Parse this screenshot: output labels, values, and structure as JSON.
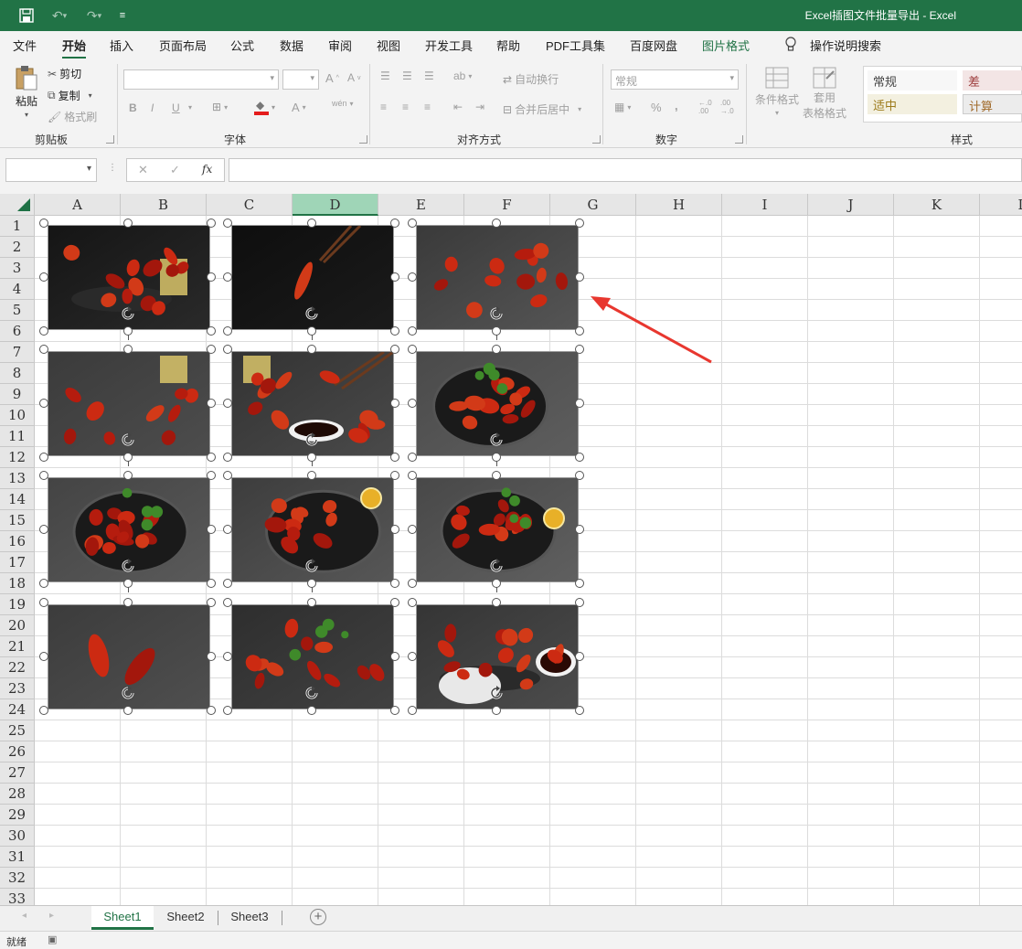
{
  "title": "Excel插图文件批量导出  -  Excel",
  "menu_tabs": [
    "文件",
    "开始",
    "插入",
    "页面布局",
    "公式",
    "数据",
    "审阅",
    "视图",
    "开发工具",
    "帮助",
    "PDF工具集",
    "百度网盘",
    "图片格式"
  ],
  "active_tab": "开始",
  "tell_me": "操作说明搜索",
  "clipboard": {
    "paste": "粘贴",
    "cut": "剪切",
    "copy": "复制",
    "format_painter": "格式刷",
    "label": "剪贴板"
  },
  "font": {
    "label": "字体",
    "bold": "B",
    "italic": "I",
    "underline": "U",
    "font_color": "A",
    "phonetic": "wén"
  },
  "alignment": {
    "label": "对齐方式",
    "wrap": "自动换行",
    "merge": "合并后居中"
  },
  "number": {
    "label": "数字",
    "format": "常规",
    "percent": "%",
    "comma": ","
  },
  "styles": {
    "label": "样式",
    "conditional": "条件格式",
    "table_line1": "套用",
    "table_line2": "表格格式",
    "cells": [
      "常规",
      "差",
      "适中",
      "计算"
    ]
  },
  "columns": [
    "A",
    "B",
    "C",
    "D",
    "E",
    "F",
    "G",
    "H",
    "I",
    "J",
    "K",
    "L"
  ],
  "selected_column": "D",
  "rows": [
    "1",
    "2",
    "3",
    "4",
    "5",
    "6",
    "7",
    "8",
    "9",
    "10",
    "11",
    "12",
    "13",
    "14",
    "15",
    "16",
    "17",
    "18",
    "19",
    "20",
    "21",
    "22",
    "23",
    "24",
    "25",
    "26",
    "27",
    "28",
    "29",
    "30",
    "31",
    "32",
    "33"
  ],
  "pictures": [
    {
      "name": "crayfish-plate-beer"
    },
    {
      "name": "crayfish-chopsticks"
    },
    {
      "name": "crayfish-pile-sauce"
    },
    {
      "name": "crayfish-bowl-beer"
    },
    {
      "name": "crayfish-chopsticks-sauce"
    },
    {
      "name": "crayfish-pan-herbs"
    },
    {
      "name": "crayfish-pan-large"
    },
    {
      "name": "crayfish-pan-lemon"
    },
    {
      "name": "crayfish-pan-cloth"
    },
    {
      "name": "crayfish-two"
    },
    {
      "name": "crayfish-spread"
    },
    {
      "name": "crayfish-plate-sauce"
    }
  ],
  "sheets": [
    "Sheet1",
    "Sheet2",
    "Sheet3"
  ],
  "active_sheet": "Sheet1",
  "status": "就绪",
  "colors": {
    "excel_green": "#217346",
    "arrow_red": "#e8372f"
  }
}
